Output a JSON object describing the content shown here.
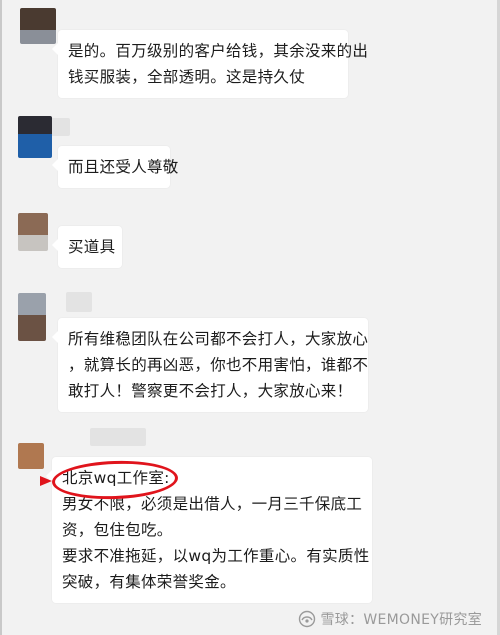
{
  "messages": [
    {
      "lines": [
        "是的。百万级别的客户给钱，其余没来的出",
        "钱买服装，全部透明。这是持久仗"
      ]
    },
    {
      "lines": [
        "而且还受人尊敬"
      ]
    },
    {
      "lines": [
        "买道具"
      ]
    },
    {
      "lines": [
        "所有维稳团队在公司都不会打人，大家放心",
        "，就算长的再凶恶，你也不用害怕，谁都不",
        "敢打人！警察更不会打人，大家放心来！"
      ]
    },
    {
      "lines": [
        "北京wq工作室:",
        "男女不限，必须是出借人，一月三千保底工",
        "资，包住包吃。",
        "要求不准拖延，以wq为工作重心。有实质性",
        "突破，有集体荣誉奖金。"
      ]
    }
  ],
  "watermark": {
    "text": "雪球：WEMONEY研究室",
    "icon": "xueqiu-snowball-icon"
  },
  "colors": {
    "background": "#f2f2f2",
    "bubble": "#ffffff",
    "highlight_circle": "#e0141c"
  }
}
